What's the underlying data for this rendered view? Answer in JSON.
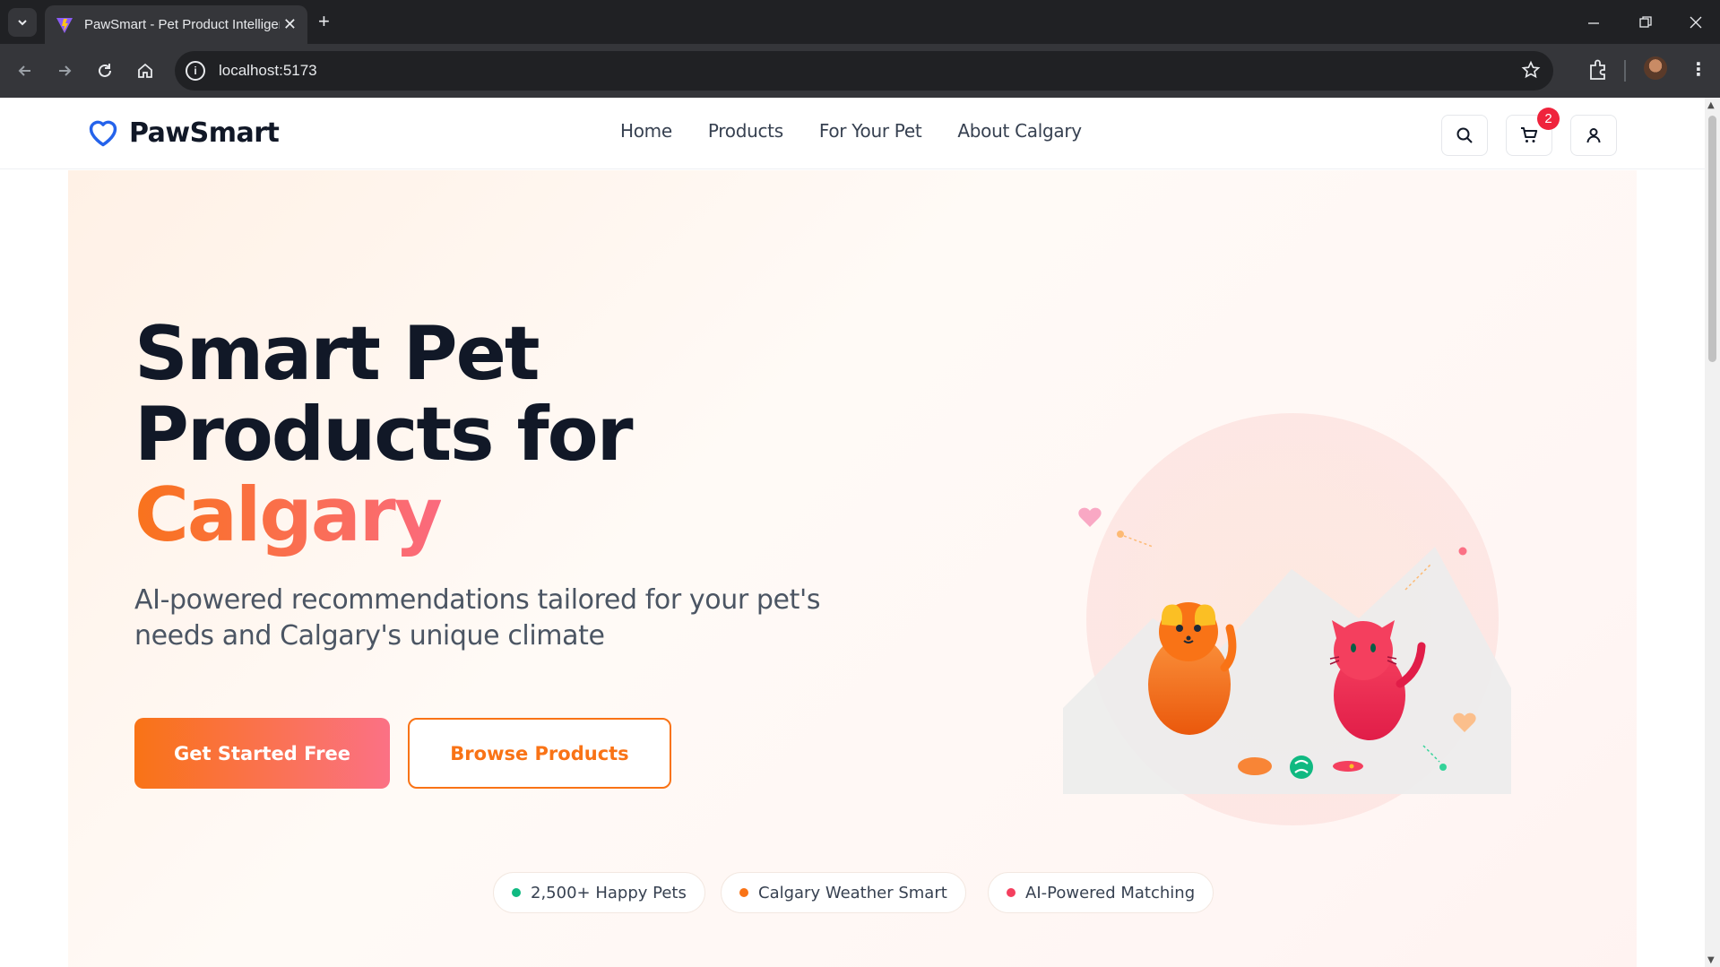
{
  "browser": {
    "tab_title": "PawSmart - Pet Product Intelligence",
    "url": "localhost:5173",
    "new_tab_symbol": "+",
    "close_symbol": "✕"
  },
  "site": {
    "brand": "PawSmart",
    "nav": [
      "Home",
      "Products",
      "For Your Pet",
      "About Calgary"
    ],
    "cart_count": "2"
  },
  "hero": {
    "title_line1": "Smart Pet",
    "title_line2": "Products for",
    "title_accent": "Calgary",
    "subtitle": "AI-powered recommendations tailored for your pet's needs and Calgary's unique climate",
    "primary_cta": "Get Started Free",
    "secondary_cta": "Browse Products"
  },
  "features": [
    {
      "label": "2,500+ Happy Pets",
      "dot_color": "#10b981"
    },
    {
      "label": "Calgary Weather Smart",
      "dot_color": "#f97316"
    },
    {
      "label": "AI-Powered Matching",
      "dot_color": "#f43f5e"
    }
  ],
  "colors": {
    "brand_blue": "#2563eb",
    "accent_orange": "#f97316",
    "accent_pink": "#fb7185"
  }
}
